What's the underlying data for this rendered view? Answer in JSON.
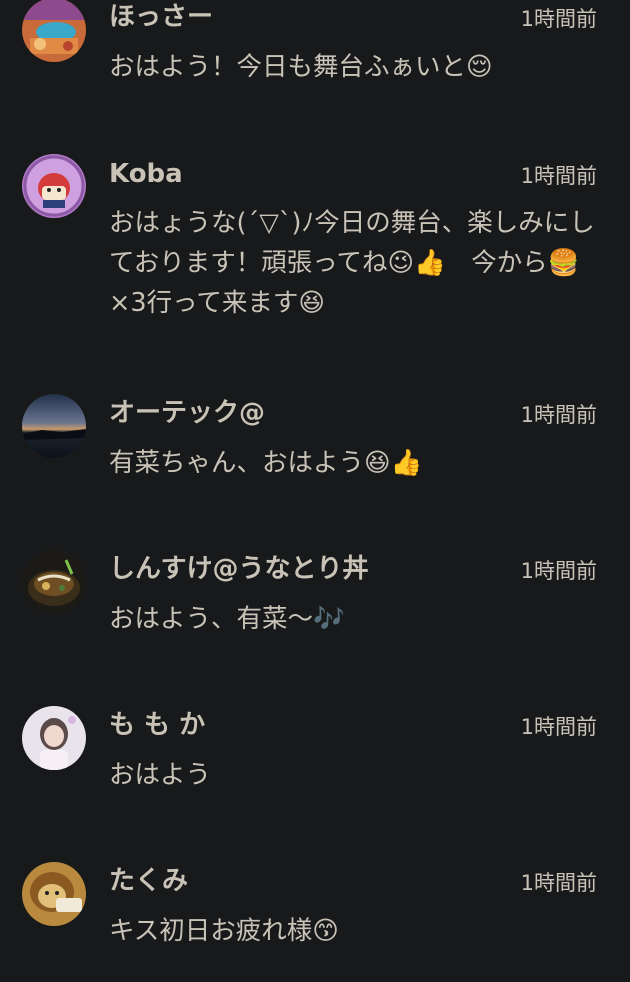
{
  "comments": [
    {
      "username": "ほっさー",
      "time": "1時間前",
      "message": "おはよう！今日も舞台ふぁいと😌"
    },
    {
      "username": "Koba",
      "time": "1時間前",
      "message": "おはょうな(´▽`)ﾉ今日の舞台、楽しみにしております！頑張ってね😉👍　今から🍔×3行って来ます😆"
    },
    {
      "username": "オーテック@",
      "time": "1時間前",
      "message": "有菜ちゃん、おはよう😆👍"
    },
    {
      "username": "しんすけ@うなとり丼",
      "time": "1時間前",
      "message": "おはよう、有菜〜🎶"
    },
    {
      "username": "も も か",
      "time": "1時間前",
      "message": "おはよう"
    },
    {
      "username": "たくみ",
      "time": "1時間前",
      "message": "キス初日お疲れ様😙"
    }
  ]
}
